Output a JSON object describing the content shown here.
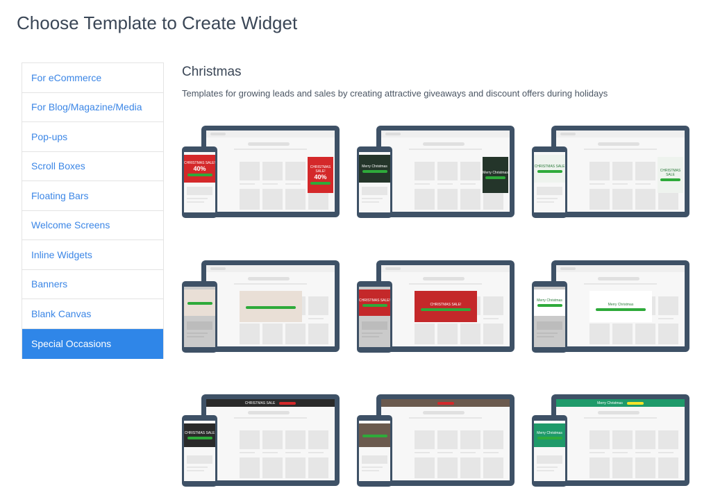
{
  "page": {
    "title": "Choose Template to Create Widget"
  },
  "sidebar": {
    "items": [
      {
        "label": "For eCommerce",
        "active": false
      },
      {
        "label": "For Blog/Magazine/Media",
        "active": false
      },
      {
        "label": "Pop-ups",
        "active": false
      },
      {
        "label": "Scroll Boxes",
        "active": false
      },
      {
        "label": "Floating Bars",
        "active": false
      },
      {
        "label": "Welcome Screens",
        "active": false
      },
      {
        "label": "Inline Widgets",
        "active": false
      },
      {
        "label": "Banners",
        "active": false
      },
      {
        "label": "Blank Canvas",
        "active": false
      },
      {
        "label": "Special Occasions",
        "active": true
      }
    ]
  },
  "section": {
    "title": "Christmas",
    "description": "Templates for growing leads and sales by creating attractive giveaways and discount offers during holidays"
  },
  "templates": [
    {
      "kind": "side",
      "color": "#d4282a",
      "headline": "CHRISTMAS SALE!",
      "value": "40%"
    },
    {
      "kind": "side",
      "color": "#24352a",
      "headline": "Merry Christmas",
      "value": ""
    },
    {
      "kind": "side",
      "color": "#eef3ee",
      "headline": "CHRISTMAS SALE",
      "value": ""
    },
    {
      "kind": "center",
      "color": "#e9dfd6",
      "headline": "",
      "value": ""
    },
    {
      "kind": "center",
      "color": "#c4282a",
      "headline": "CHRISTMAS SALE!",
      "value": ""
    },
    {
      "kind": "center",
      "color": "#ffffff",
      "headline": "Merry Christmas",
      "value": ""
    },
    {
      "kind": "bar",
      "color": "#2a2a2a",
      "headline": "CHRISTMAS SALE",
      "value": ""
    },
    {
      "kind": "bar",
      "color": "#6b5a4e",
      "headline": "",
      "value": ""
    },
    {
      "kind": "bar",
      "color": "#1f9a6a",
      "headline": "Merry Christmas",
      "value": ""
    }
  ]
}
